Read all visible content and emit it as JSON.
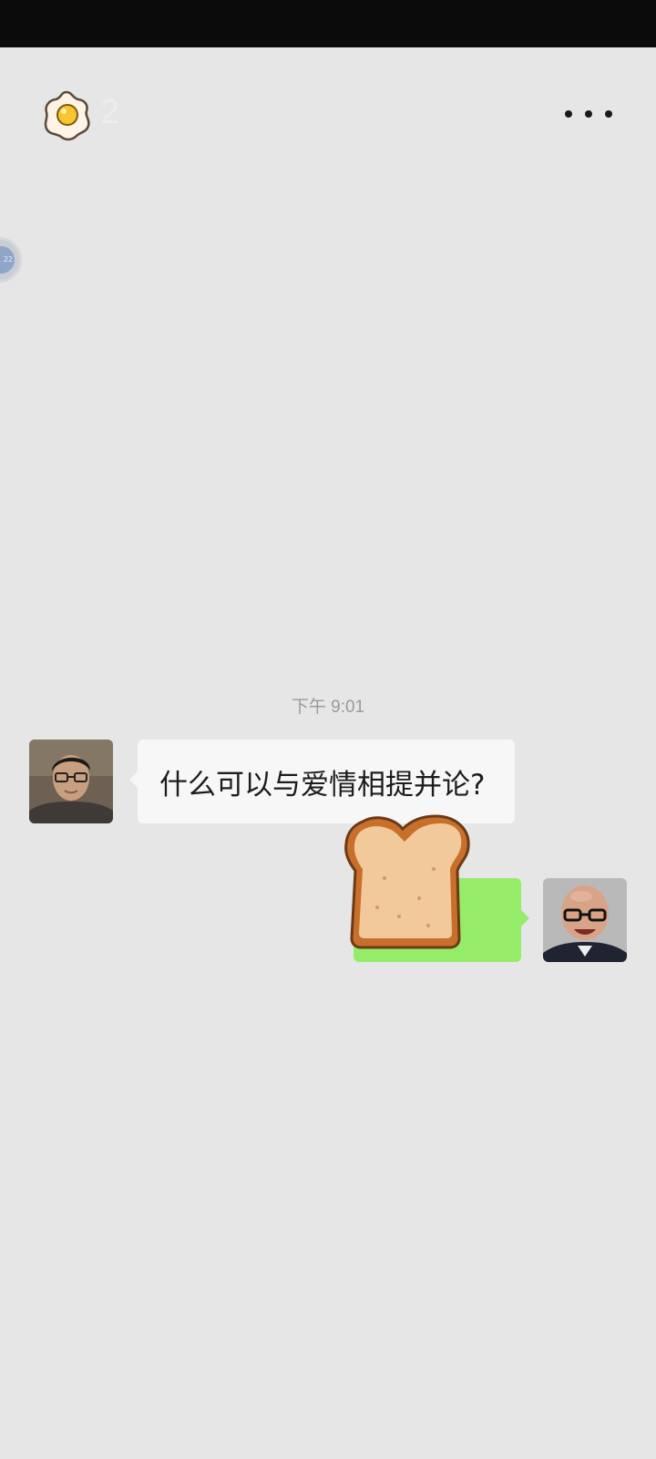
{
  "status_bar": {},
  "header": {
    "egg_icon": "fried-egg-icon",
    "egg_count": "2",
    "more_icon": "more-icon"
  },
  "floating_widget": {
    "icon": "floating-window-icon",
    "text": "22"
  },
  "chat": {
    "timestamp": "下午 9:01",
    "messages": [
      {
        "side": "left",
        "sender_avatar": "avatar-young-man-glasses",
        "text": "什么可以与爱情相提并论?"
      },
      {
        "side": "right",
        "sender_avatar": "avatar-bald-man-glasses",
        "text": "",
        "sticker": "toast-bread-sticker"
      }
    ]
  },
  "colors": {
    "background": "#e6e6e6",
    "bubble_incoming": "#f7f7f7",
    "bubble_outgoing": "#95ec69",
    "status_bar": "#0b0b0b"
  }
}
